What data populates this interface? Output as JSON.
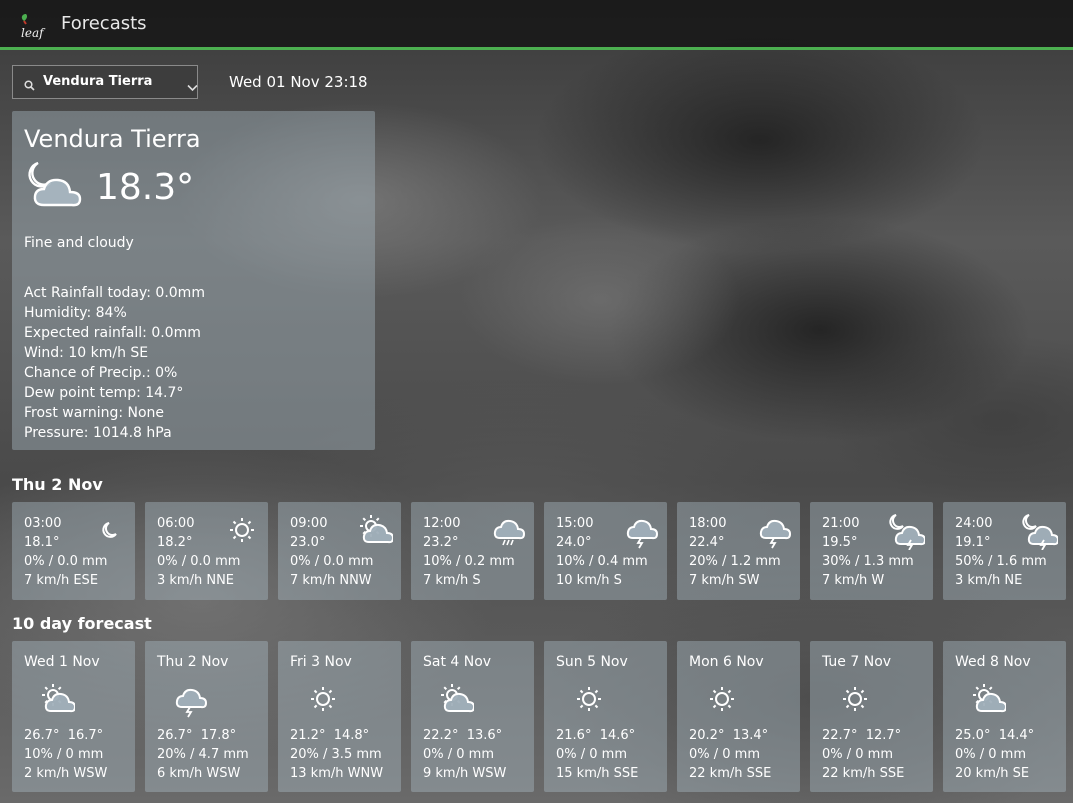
{
  "header": {
    "app_title": "Forecasts",
    "logo_text": "leaf",
    "accent_color": "#4caf50"
  },
  "toolbar": {
    "location_value": "Vendura Tierra",
    "datetime": "Wed 01 Nov 23:18"
  },
  "current": {
    "city": "Vendura Tierra",
    "icon": "moon-cloud-icon",
    "temp": "18.3°",
    "description": "Fine and cloudy",
    "details": [
      "Act Rainfall today: 0.0mm",
      "Humidity: 84%",
      "Expected rainfall: 0.0mm",
      "Wind: 10 km/h SE",
      "Chance of Precip.: 0%",
      "Dew point temp: 14.7°",
      "Frost warning: None",
      "Pressure: 1014.8 hPa"
    ]
  },
  "hourly": {
    "title": "Thu 2 Nov",
    "items": [
      {
        "time": "03:00",
        "temp": "18.1°",
        "rain": "0% / 0.0 mm",
        "wind": "7 km/h ESE",
        "icon": "moon-icon"
      },
      {
        "time": "06:00",
        "temp": "18.2°",
        "rain": "0% / 0.0 mm",
        "wind": "3 km/h NNE",
        "icon": "sun-icon"
      },
      {
        "time": "09:00",
        "temp": "23.0°",
        "rain": "0% / 0.0 mm",
        "wind": "7 km/h NNW",
        "icon": "sun-cloud-icon"
      },
      {
        "time": "12:00",
        "temp": "23.2°",
        "rain": "10% / 0.2 mm",
        "wind": "7 km/h S",
        "icon": "rain-cloud-icon"
      },
      {
        "time": "15:00",
        "temp": "24.0°",
        "rain": "10% / 0.4 mm",
        "wind": "10 km/h S",
        "icon": "storm-cloud-icon"
      },
      {
        "time": "18:00",
        "temp": "22.4°",
        "rain": "20% / 1.2 mm",
        "wind": "7 km/h SW",
        "icon": "storm-cloud-icon"
      },
      {
        "time": "21:00",
        "temp": "19.5°",
        "rain": "30% / 1.3 mm",
        "wind": "7 km/h W",
        "icon": "moon-storm-icon"
      },
      {
        "time": "24:00",
        "temp": "19.1°",
        "rain": "50% / 1.6 mm",
        "wind": "3 km/h NE",
        "icon": "moon-storm-icon"
      }
    ]
  },
  "daily": {
    "title": "10 day forecast",
    "items": [
      {
        "day": "Wed 1 Nov",
        "temps": "26.7°  16.7°",
        "rain": "10% / 0 mm",
        "wind": "2 km/h WSW",
        "icon": "sun-cloud-icon"
      },
      {
        "day": "Thu 2 Nov",
        "temps": "26.7°  17.8°",
        "rain": "20% / 4.7 mm",
        "wind": "6 km/h WSW",
        "icon": "storm-cloud-icon"
      },
      {
        "day": "Fri 3 Nov",
        "temps": "21.2°  14.8°",
        "rain": "20% / 3.5 mm",
        "wind": "13 km/h WNW",
        "icon": "sun-icon"
      },
      {
        "day": "Sat 4 Nov",
        "temps": "22.2°  13.6°",
        "rain": "0% / 0 mm",
        "wind": "9 km/h WSW",
        "icon": "sun-cloud-icon"
      },
      {
        "day": "Sun 5 Nov",
        "temps": "21.6°  14.6°",
        "rain": "0% / 0 mm",
        "wind": "15 km/h SSE",
        "icon": "sun-icon"
      },
      {
        "day": "Mon 6 Nov",
        "temps": "20.2°  13.4°",
        "rain": "0% / 0 mm",
        "wind": "22 km/h SSE",
        "icon": "sun-icon"
      },
      {
        "day": "Tue 7 Nov",
        "temps": "22.7°  12.7°",
        "rain": "0% / 0 mm",
        "wind": "22 km/h SSE",
        "icon": "sun-icon"
      },
      {
        "day": "Wed 8 Nov",
        "temps": "25.0°  14.4°",
        "rain": "0% / 0 mm",
        "wind": "20 km/h SE",
        "icon": "sun-cloud-icon"
      }
    ]
  }
}
